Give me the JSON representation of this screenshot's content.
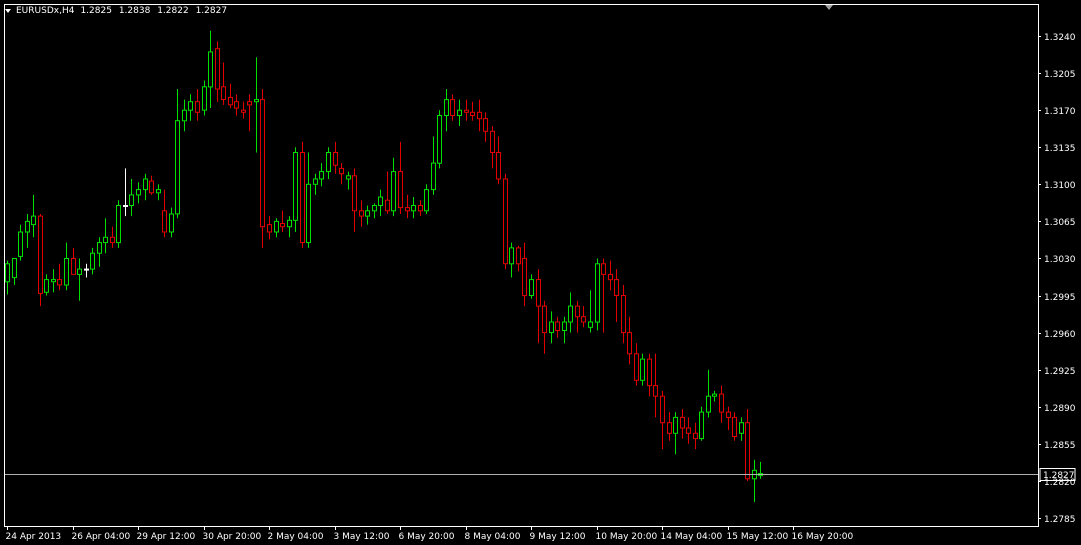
{
  "header": {
    "symbol": "EURUSDx,H4",
    "ohlc": [
      "1.2825",
      "1.2838",
      "1.2822",
      "1.2827"
    ],
    "menu_icon": "triangle-down-icon"
  },
  "colors": {
    "background": "#000000",
    "frame": "#ffffff",
    "bull": "#00e000",
    "bear": "#e00000",
    "doji": "#ffffff",
    "bid_line": "#b0b0b0",
    "text": "#ffffff"
  },
  "price_tag": "1.2827",
  "chart_data": {
    "type": "candlestick",
    "symbol": "EURUSDx",
    "timeframe": "H4",
    "grid": false,
    "ylim": [
      1.2765,
      1.326
    ],
    "y_ticks": [
      "1.3240",
      "1.3205",
      "1.3170",
      "1.3135",
      "1.3100",
      "1.3065",
      "1.3030",
      "1.2995",
      "1.2960",
      "1.2925",
      "1.2890",
      "1.2855",
      "1.2820",
      "1.2785"
    ],
    "x_ticks": [
      {
        "label": "24 Apr 2013",
        "bar": 0
      },
      {
        "label": "26 Apr 04:00",
        "bar": 10
      },
      {
        "label": "29 Apr 12:00",
        "bar": 20
      },
      {
        "label": "30 Apr 20:00",
        "bar": 30
      },
      {
        "label": "2 May 04:00",
        "bar": 40
      },
      {
        "label": "3 May 12:00",
        "bar": 50
      },
      {
        "label": "6 May 20:00",
        "bar": 60
      },
      {
        "label": "8 May 04:00",
        "bar": 70
      },
      {
        "label": "9 May 12:00",
        "bar": 80
      },
      {
        "label": "10 May 20:00",
        "bar": 90
      },
      {
        "label": "14 May 04:00",
        "bar": 100
      },
      {
        "label": "15 May 12:00",
        "bar": 110
      },
      {
        "label": "16 May 20:00",
        "bar": 120
      }
    ],
    "current_price": 1.2827,
    "candles": [
      [
        1.3008,
        1.3028,
        1.2996,
        1.3025
      ],
      [
        1.3012,
        1.303,
        1.3005,
        1.303
      ],
      [
        1.3032,
        1.3062,
        1.3028,
        1.3055
      ],
      [
        1.3055,
        1.3072,
        1.304,
        1.3065
      ],
      [
        1.3062,
        1.309,
        1.305,
        1.307
      ],
      [
        1.307,
        1.3072,
        1.2985,
        1.2997
      ],
      [
        1.2998,
        1.3015,
        1.2995,
        1.301
      ],
      [
        1.3008,
        1.302,
        1.2998,
        1.301
      ],
      [
        1.301,
        1.3025,
        1.3,
        1.3005
      ],
      [
        1.3005,
        1.3045,
        1.3,
        1.303
      ],
      [
        1.303,
        1.304,
        1.3015,
        1.3015
      ],
      [
        1.3015,
        1.303,
        1.299,
        1.302
      ],
      [
        1.302,
        1.3025,
        1.3012,
        1.302
      ],
      [
        1.302,
        1.304,
        1.3015,
        1.3035
      ],
      [
        1.3035,
        1.305,
        1.3022,
        1.3045
      ],
      [
        1.3045,
        1.3068,
        1.3035,
        1.305
      ],
      [
        1.305,
        1.306,
        1.304,
        1.3045
      ],
      [
        1.3045,
        1.3085,
        1.304,
        1.308
      ],
      [
        1.308,
        1.3115,
        1.307,
        1.308
      ],
      [
        1.308,
        1.3105,
        1.307,
        1.309
      ],
      [
        1.309,
        1.3102,
        1.3082,
        1.3095
      ],
      [
        1.3095,
        1.311,
        1.3085,
        1.3105
      ],
      [
        1.3103,
        1.3108,
        1.309,
        1.3092
      ],
      [
        1.3092,
        1.31,
        1.3085,
        1.3095
      ],
      [
        1.3075,
        1.3095,
        1.305,
        1.3055
      ],
      [
        1.3055,
        1.3078,
        1.305,
        1.3072
      ],
      [
        1.3072,
        1.319,
        1.3068,
        1.316
      ],
      [
        1.316,
        1.318,
        1.315,
        1.317
      ],
      [
        1.317,
        1.3185,
        1.316,
        1.3178
      ],
      [
        1.3178,
        1.319,
        1.316,
        1.3168
      ],
      [
        1.317,
        1.3198,
        1.3165,
        1.3192
      ],
      [
        1.3192,
        1.3245,
        1.3172,
        1.3225
      ],
      [
        1.3228,
        1.3235,
        1.3178,
        1.319
      ],
      [
        1.3192,
        1.3215,
        1.3175,
        1.318
      ],
      [
        1.3182,
        1.3195,
        1.3172,
        1.3175
      ],
      [
        1.3178,
        1.3185,
        1.3165,
        1.3172
      ],
      [
        1.317,
        1.3178,
        1.3162,
        1.3168
      ],
      [
        1.3178,
        1.3185,
        1.315,
        1.3175
      ],
      [
        1.3178,
        1.322,
        1.313,
        1.318
      ],
      [
        1.318,
        1.319,
        1.304,
        1.306
      ],
      [
        1.3062,
        1.307,
        1.3048,
        1.3055
      ],
      [
        1.3055,
        1.3068,
        1.305,
        1.3065
      ],
      [
        1.3063,
        1.3075,
        1.3055,
        1.306
      ],
      [
        1.306,
        1.307,
        1.305,
        1.3066
      ],
      [
        1.3066,
        1.3135,
        1.3055,
        1.313
      ],
      [
        1.313,
        1.314,
        1.304,
        1.3045
      ],
      [
        1.3045,
        1.313,
        1.304,
        1.31
      ],
      [
        1.31,
        1.311,
        1.309,
        1.3105
      ],
      [
        1.3105,
        1.312,
        1.3098,
        1.3112
      ],
      [
        1.3112,
        1.3135,
        1.3105,
        1.313
      ],
      [
        1.313,
        1.314,
        1.311,
        1.3118
      ],
      [
        1.3115,
        1.312,
        1.31,
        1.311
      ],
      [
        1.3105,
        1.3112,
        1.3095,
        1.3108
      ],
      [
        1.3108,
        1.3115,
        1.3055,
        1.3075
      ],
      [
        1.3075,
        1.3085,
        1.306,
        1.307
      ],
      [
        1.307,
        1.308,
        1.3062,
        1.3075
      ],
      [
        1.3075,
        1.3082,
        1.3068,
        1.308
      ],
      [
        1.308,
        1.3095,
        1.307,
        1.3088
      ],
      [
        1.3085,
        1.3112,
        1.3072,
        1.3075
      ],
      [
        1.3075,
        1.3125,
        1.307,
        1.3112
      ],
      [
        1.3112,
        1.314,
        1.3072,
        1.3078
      ],
      [
        1.3078,
        1.309,
        1.3068,
        1.3075
      ],
      [
        1.3075,
        1.3088,
        1.3068,
        1.308
      ],
      [
        1.308,
        1.3085,
        1.307,
        1.3075
      ],
      [
        1.3075,
        1.31,
        1.3072,
        1.3095
      ],
      [
        1.3095,
        1.3145,
        1.309,
        1.312
      ],
      [
        1.312,
        1.317,
        1.3115,
        1.3165
      ],
      [
        1.3165,
        1.319,
        1.315,
        1.318
      ],
      [
        1.318,
        1.3185,
        1.316,
        1.3165
      ],
      [
        1.3165,
        1.318,
        1.3155,
        1.317
      ],
      [
        1.317,
        1.318,
        1.316,
        1.3168
      ],
      [
        1.3168,
        1.3178,
        1.316,
        1.3165
      ],
      [
        1.3168,
        1.318,
        1.315,
        1.3162
      ],
      [
        1.3162,
        1.3168,
        1.314,
        1.315
      ],
      [
        1.315,
        1.3155,
        1.3115,
        1.313
      ],
      [
        1.313,
        1.3145,
        1.31,
        1.3105
      ],
      [
        1.3105,
        1.311,
        1.302,
        1.3025
      ],
      [
        1.3025,
        1.3045,
        1.3012,
        1.304
      ],
      [
        1.304,
        1.3042,
        1.3018,
        1.3025
      ],
      [
        1.303,
        1.3045,
        1.2985,
        1.2995
      ],
      [
        1.2995,
        1.3015,
        1.2992,
        1.301
      ],
      [
        1.301,
        1.302,
        1.295,
        1.2985
      ],
      [
        1.2985,
        1.299,
        1.294,
        1.296
      ],
      [
        1.296,
        1.298,
        1.295,
        1.297
      ],
      [
        1.297,
        1.2975,
        1.2955,
        1.2962
      ],
      [
        1.2962,
        1.2975,
        1.295,
        1.297
      ],
      [
        1.297,
        1.2998,
        1.296,
        1.2985
      ],
      [
        1.2985,
        1.299,
        1.296,
        1.2975
      ],
      [
        1.2975,
        1.2985,
        1.2965,
        1.297
      ],
      [
        1.2965,
        1.3,
        1.296,
        1.297
      ],
      [
        1.297,
        1.303,
        1.2962,
        1.3025
      ],
      [
        1.3025,
        1.303,
        1.296,
        1.3015
      ],
      [
        1.3015,
        1.3028,
        1.3,
        1.301
      ],
      [
        1.301,
        1.302,
        1.297,
        1.2995
      ],
      [
        1.2995,
        1.3005,
        1.295,
        1.296
      ],
      [
        1.296,
        1.2975,
        1.293,
        1.294
      ],
      [
        1.294,
        1.295,
        1.291,
        1.2915
      ],
      [
        1.2915,
        1.294,
        1.291,
        1.2935
      ],
      [
        1.2935,
        1.294,
        1.29,
        1.291
      ],
      [
        1.291,
        1.294,
        1.288,
        1.29
      ],
      [
        1.29,
        1.2905,
        1.285,
        1.2875
      ],
      [
        1.2875,
        1.2885,
        1.2858,
        1.2865
      ],
      [
        1.2865,
        1.2885,
        1.2845,
        1.288
      ],
      [
        1.288,
        1.2888,
        1.286,
        1.287
      ],
      [
        1.287,
        1.288,
        1.2855,
        1.2865
      ],
      [
        1.2865,
        1.2875,
        1.285,
        1.286
      ],
      [
        1.286,
        1.289,
        1.2858,
        1.2885
      ],
      [
        1.2885,
        1.2925,
        1.288,
        1.29
      ],
      [
        1.29,
        1.2905,
        1.2895,
        1.2902
      ],
      [
        1.2902,
        1.291,
        1.2875,
        1.2885
      ],
      [
        1.2885,
        1.289,
        1.2868,
        1.288
      ],
      [
        1.288,
        1.2885,
        1.2858,
        1.2862
      ],
      [
        1.2865,
        1.288,
        1.2858,
        1.2875
      ],
      [
        1.2875,
        1.2888,
        1.282,
        1.2822
      ],
      [
        1.2822,
        1.284,
        1.28,
        1.283
      ],
      [
        1.2825,
        1.2838,
        1.2822,
        1.2827
      ]
    ]
  }
}
